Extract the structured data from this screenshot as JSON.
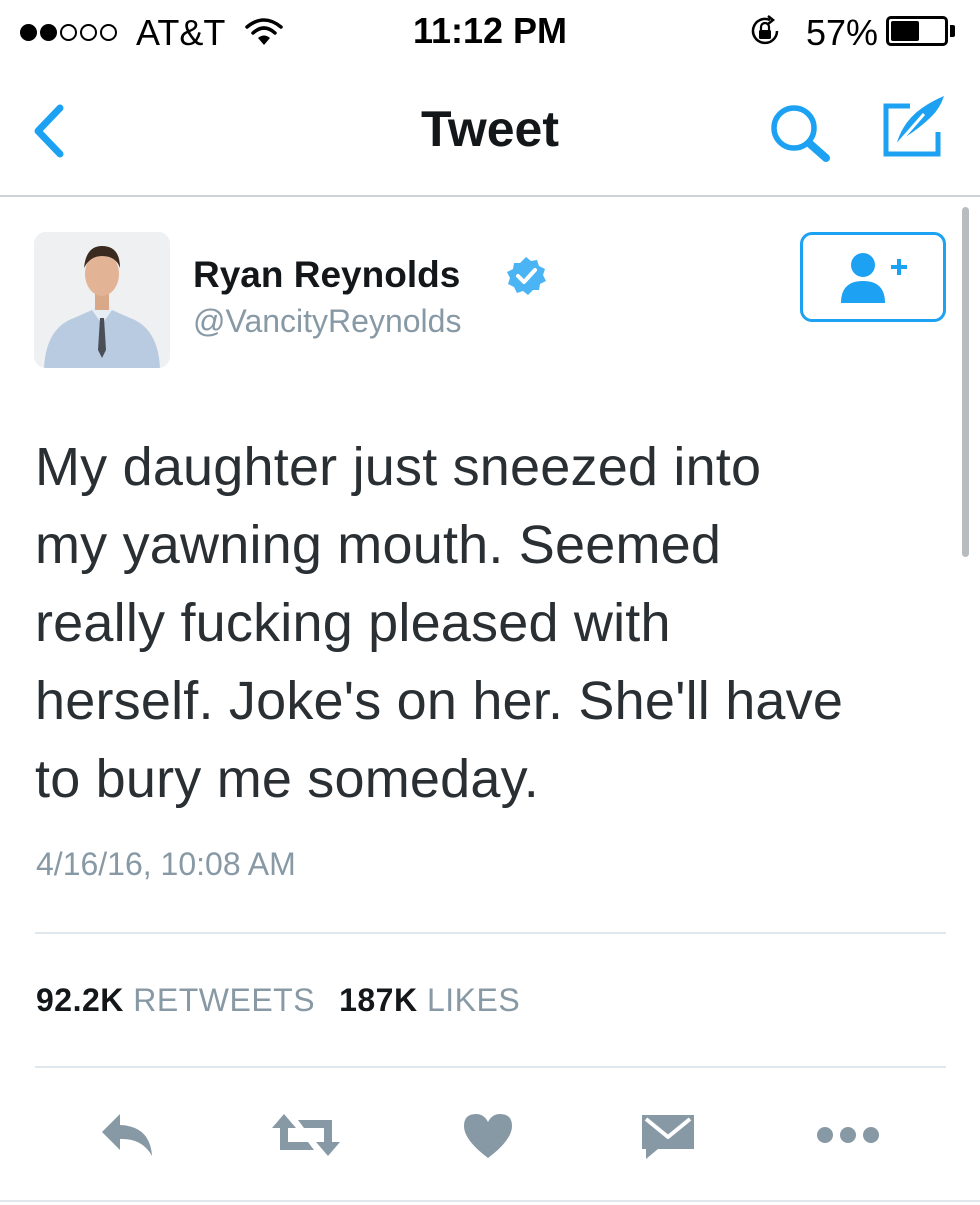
{
  "status_bar": {
    "carrier": "AT&T",
    "time": "11:12 PM",
    "battery_percent": "57%",
    "signal_bars_filled": 2,
    "signal_bars_total": 5,
    "battery_level": 0.57
  },
  "nav": {
    "title": "Tweet",
    "back_icon": "chevron-left-icon",
    "search_icon": "search-icon",
    "compose_icon": "compose-tweet-icon"
  },
  "tweet": {
    "author_name": "Ryan Reynolds",
    "author_handle": "@VancityReynolds",
    "verified": true,
    "text_lines": [
      "My daughter just sneezed into",
      "my yawning mouth. Seemed",
      "really fucking pleased with",
      "herself. Joke's on her. She'll have",
      "to bury me someday."
    ],
    "timestamp": "4/16/16, 10:08 AM",
    "retweets_count": "92.2K",
    "retweets_label": "RETWEETS",
    "likes_count": "187K",
    "likes_label": "LIKES"
  },
  "actions": [
    {
      "name": "reply",
      "icon": "reply-icon"
    },
    {
      "name": "retweet",
      "icon": "retweet-icon"
    },
    {
      "name": "like",
      "icon": "heart-icon"
    },
    {
      "name": "direct-message",
      "icon": "envelope-icon"
    },
    {
      "name": "more",
      "icon": "more-icon"
    }
  ],
  "colors": {
    "accent": "#1da1f2",
    "text": "#292f33",
    "muted": "#8899a6",
    "action_icons": "#8899a6",
    "divider": "#e1e8ed"
  }
}
